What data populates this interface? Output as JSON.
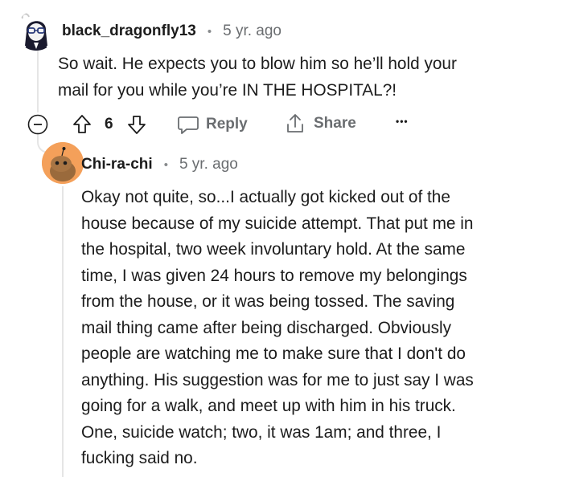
{
  "parent_comment": {
    "author": "black_dragonfly13",
    "age": "5 yr. ago",
    "body_lines": [
      "So wait. He expects you to blow him so he’ll hold your",
      "mail for you while you’re IN THE HOSPITAL?!"
    ],
    "score": "6",
    "reply_label": "Reply",
    "share_label": "Share",
    "more_label": "•••"
  },
  "reply_comment": {
    "author": "Chi-ra-chi",
    "age": "5 yr. ago",
    "body_lines": [
      "Okay not quite, so...I actually got kicked out of the",
      "house because of my suicide attempt. That put me in",
      "the hospital, two week involuntary hold. At the same",
      "time, I was given 24 hours to remove my belongings",
      "from the house, or it was being tossed. The saving",
      "mail thing came after being discharged. Obviously",
      "people are watching me to make sure that I don't do",
      "anything. His suggestion was for me to just say I was",
      "going for a walk, and meet up with him in his truck.",
      "One, suicide watch; two, it was 1am; and three, I",
      "fucking said no."
    ]
  },
  "separator": "•",
  "colors": {
    "text": "#1c1c1c",
    "meta": "#6a6d70",
    "thread_line": "#e5e5e5",
    "reply_avatar_bg": "#f4a05a"
  }
}
